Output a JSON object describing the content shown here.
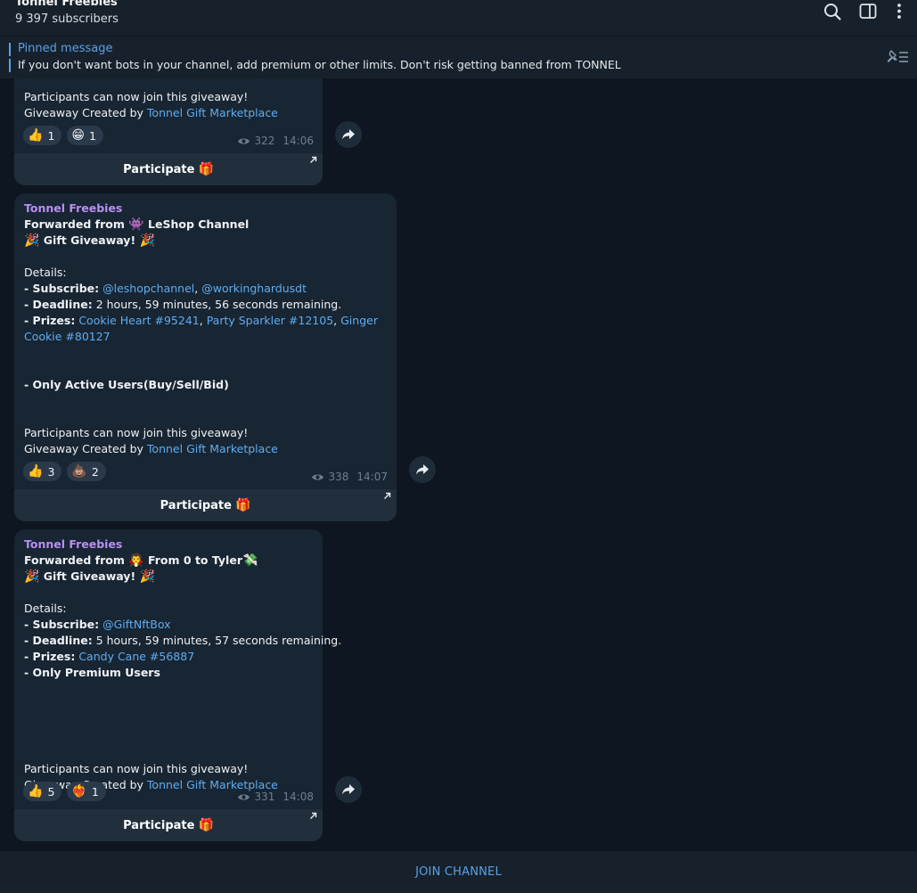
{
  "header": {
    "title": "Tonnel Freebies",
    "subtitle": "9 397 subscribers",
    "icons": [
      "search-icon",
      "sidebar-toggle-icon",
      "more-vertical-icon"
    ]
  },
  "pinned": {
    "label": "Pinned message",
    "text": "If you don't want bots in your channel, add premium or other limits. Don't risk getting banned from TONNEL",
    "icon": "pinned-list-icon"
  },
  "messages": [
    {
      "line1": "Participants can now join this giveaway!",
      "created_prefix": "Giveaway Created by ",
      "created_link": "Tonnel Gift Marketplace",
      "reactions": [
        {
          "emoji": "👍",
          "count": "1"
        },
        {
          "emoji": "😁",
          "count": "1"
        }
      ],
      "views": "322",
      "time": "14:06",
      "button_label": "Participate",
      "button_emoji": "🎁"
    },
    {
      "sender": "Tonnel Freebies",
      "forwarded_prefix": "Forwarded from ",
      "forwarded_emoji": "👾",
      "forwarded_name": "LeShop Channel",
      "headline_emoji": "🎉",
      "headline": "Gift Giveaway!",
      "details_label": "Details:",
      "subscribe_label": "- Subscribe:",
      "subscribe_link_1": "@leshopchannel",
      "subscribe_sep": ", ",
      "subscribe_link_2": "@workinghardusdt",
      "deadline_label": "- Deadline:",
      "deadline_value": " 2 hours, 59 minutes, 56 seconds remaining.",
      "prizes_label": "- Prizes:",
      "prize_1": "Cookie Heart #95241",
      "prize_sep": ", ",
      "prize_2": "Party Sparkler #12105",
      "prize_3": "Ginger Cookie #80127",
      "condition": "- Only Active Users(Buy/Sell/Bid)",
      "line1": "Participants can now join this giveaway!",
      "created_prefix": "Giveaway Created by ",
      "created_link": "Tonnel Gift Marketplace",
      "reactions": [
        {
          "emoji": "👍",
          "count": "3"
        },
        {
          "emoji": "💩",
          "count": "2"
        }
      ],
      "views": "338",
      "time": "14:07",
      "button_label": "Participate",
      "button_emoji": "🎁"
    },
    {
      "sender": "Tonnel Freebies",
      "forwarded_prefix": "Forwarded from ",
      "forwarded_emoji": "🧛",
      "forwarded_name": "From 0 to Tyler",
      "forwarded_suffix_emoji": "💸",
      "headline_emoji": "🎉",
      "headline": "Gift Giveaway!",
      "details_label": "Details:",
      "subscribe_label": "- Subscribe:",
      "subscribe_link_1": "@GiftNftBox",
      "deadline_label": "- Deadline:",
      "deadline_value": " 5 hours, 59 minutes, 57 seconds remaining.",
      "prizes_label": "- Prizes:",
      "prize_1": "Candy Cane #56887",
      "condition": "- Only Premium Users",
      "line1": "Participants can now join this giveaway!",
      "created_prefix": "Giveaway Created by ",
      "created_link": "Tonnel Gift Marketplace",
      "reactions": [
        {
          "emoji": "👍",
          "count": "5"
        },
        {
          "emoji": "❤️‍🔥",
          "count": "1"
        }
      ],
      "views": "331",
      "time": "14:08",
      "button_label": "Participate",
      "button_emoji": "🎁"
    }
  ],
  "footer": {
    "join_label": "JOIN CHANNEL"
  },
  "colors": {
    "background": "#0e1621",
    "panel": "#17212b",
    "bubble": "#182533",
    "accent": "#5aa0e8",
    "link": "#5eadf2",
    "sender": "#b98ef3"
  }
}
